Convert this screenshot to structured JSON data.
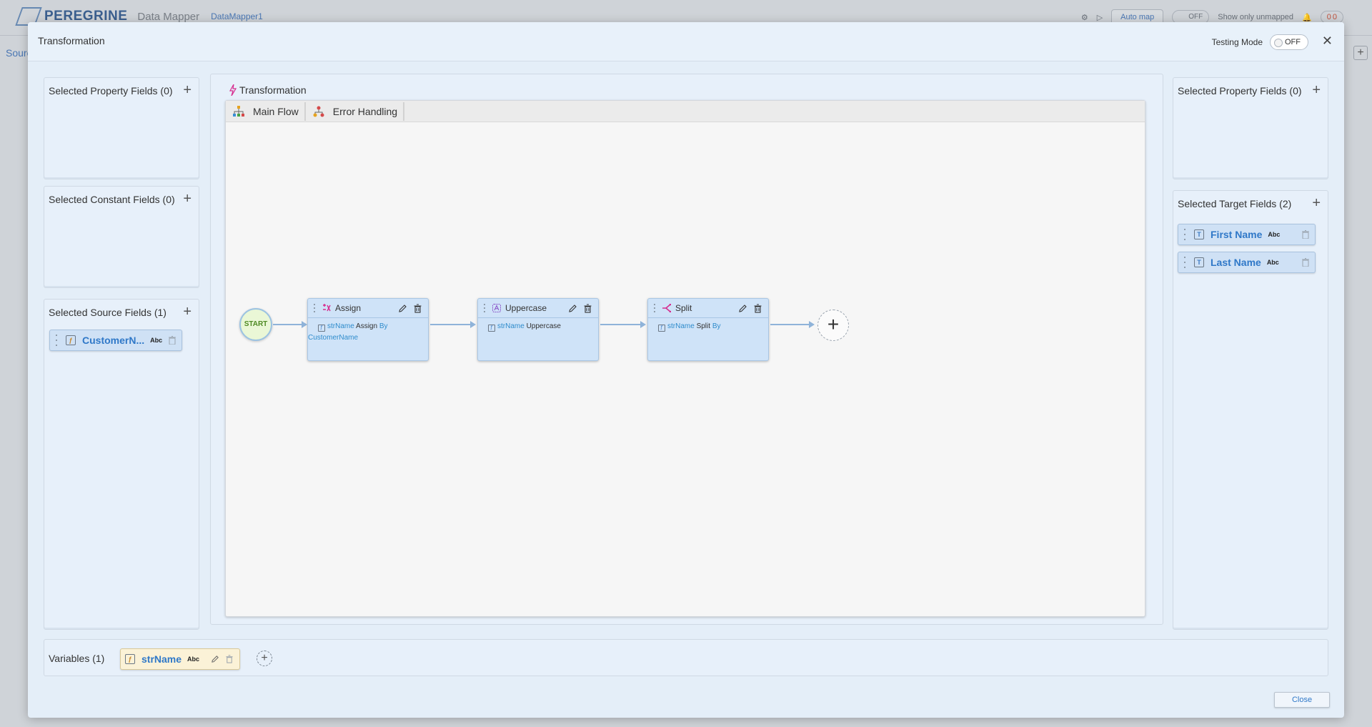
{
  "background": {
    "brand": "PEREGRINE",
    "product": "Data Mapper",
    "mapper_name": "DataMapper1",
    "auto_map": "Auto map",
    "toggle_off": "OFF",
    "show_only_unmapped": "Show only unmapped",
    "badge_a": "0",
    "badge_b": "0",
    "source_label": "Sourc"
  },
  "modal": {
    "title": "Transformation",
    "testing_mode_label": "Testing Mode",
    "testing_mode_value": "OFF",
    "close_label": "Close"
  },
  "left": {
    "property_fields_title": "Selected Property Fields (0)",
    "constant_fields_title": "Selected Constant Fields (0)",
    "source_fields_title": "Selected Source Fields (1)",
    "source_fields": [
      {
        "name": "CustomerN...",
        "type": "Abc"
      }
    ]
  },
  "right": {
    "property_fields_title": "Selected Property Fields (0)",
    "target_fields_title": "Selected Target Fields (2)",
    "target_fields": [
      {
        "name": "First Name",
        "type": "Abc"
      },
      {
        "name": "Last Name",
        "type": "Abc"
      }
    ]
  },
  "center": {
    "title": "Transformation",
    "tabs": [
      {
        "label": "Main Flow"
      },
      {
        "label": "Error Handling"
      }
    ],
    "start_label": "START",
    "steps": [
      {
        "name": "Assign",
        "var": "strName",
        "op": "Assign",
        "kw": "By",
        "arg": "CustomerName"
      },
      {
        "name": "Uppercase",
        "var": "strName",
        "op": "Uppercase",
        "kw": "",
        "arg": ""
      },
      {
        "name": "Split",
        "var": "strName",
        "op": "Split",
        "kw": "By",
        "arg": ""
      }
    ],
    "add_label": "+"
  },
  "variables": {
    "title": "Variables (1)",
    "items": [
      {
        "name": "strName",
        "type": "Abc"
      }
    ]
  },
  "colors": {
    "accent": "#2f78c8",
    "step_bg": "#cfe3f8",
    "variable_bg": "#fbf2d7",
    "start_bg": "#eaf7d6"
  }
}
